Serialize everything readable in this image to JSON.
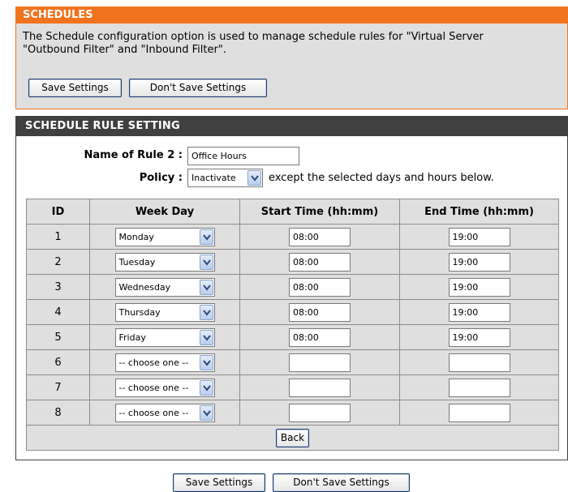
{
  "schedules": {
    "title": "SCHEDULES",
    "desc_line1": "The Schedule configuration option is used to manage schedule rules for \"Virtual Server",
    "desc_line2": "\"Outbound Filter\" and \"Inbound Filter\".",
    "save_label": "Save Settings",
    "dont_save_label": "Don't Save Settings"
  },
  "rule": {
    "title": "SCHEDULE RULE SETTING",
    "name_label": "Name of Rule 2 :",
    "name_value": "Office Hours",
    "policy_label": "Policy :",
    "policy_value": "Inactivate",
    "policy_suffix": "except the selected days and hours below.",
    "columns": [
      "ID",
      "Week Day",
      "Start Time (hh:mm)",
      "End Time (hh:mm)"
    ],
    "rows": [
      {
        "id": "1",
        "day": "Monday",
        "start": "08:00",
        "end": "19:00"
      },
      {
        "id": "2",
        "day": "Tuesday",
        "start": "08:00",
        "end": "19:00"
      },
      {
        "id": "3",
        "day": "Wednesday",
        "start": "08:00",
        "end": "19:00"
      },
      {
        "id": "4",
        "day": "Thursday",
        "start": "08:00",
        "end": "19:00"
      },
      {
        "id": "5",
        "day": "Friday",
        "start": "08:00",
        "end": "19:00"
      },
      {
        "id": "6",
        "day": "-- choose one --",
        "start": "",
        "end": ""
      },
      {
        "id": "7",
        "day": "-- choose one --",
        "start": "",
        "end": ""
      },
      {
        "id": "8",
        "day": "-- choose one --",
        "start": "",
        "end": ""
      }
    ],
    "back_label": "Back"
  },
  "footer": {
    "save_label": "Save Settings",
    "dont_save_label": "Don't Save Settings"
  },
  "colors": {
    "accent_orange": "#f2731f",
    "header_dark": "#404040",
    "panel_gray": "#dfdfdf"
  },
  "icons": {
    "dropdown": "chevron-down-icon"
  }
}
